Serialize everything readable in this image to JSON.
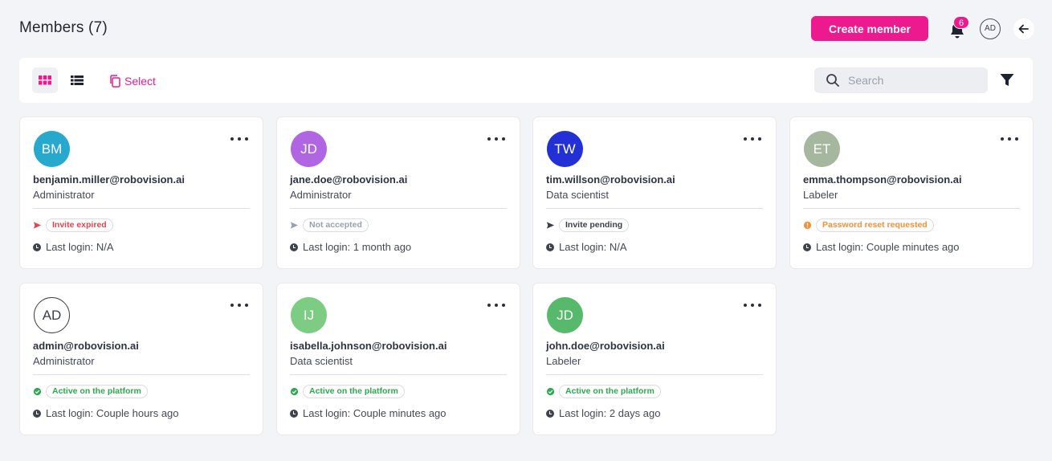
{
  "header": {
    "title": "Members (7)",
    "create_label": "Create member",
    "notification_count": "6",
    "user_initials": "AD",
    "accent": "#ec1a8e"
  },
  "toolbar": {
    "select_label": "Select",
    "search_placeholder": "Search",
    "search_value": ""
  },
  "members": [
    {
      "initials": "BM",
      "email": "benjamin.miller@robovision.ai",
      "role": "Administrator",
      "status": "Invite expired",
      "status_color": "#e2474f",
      "status_icon": "send-icon",
      "last_login": "Last login: N/A",
      "avatar_color": "#27a8cd"
    },
    {
      "initials": "JD",
      "email": "jane.doe@robovision.ai",
      "role": "Administrator",
      "status": "Not accepted",
      "status_color": "#9aa0b2",
      "status_icon": "send-icon",
      "last_login": "Last login: 1 month ago",
      "avatar_color": "#b066e3"
    },
    {
      "initials": "TW",
      "email": "tim.willson@robovision.ai",
      "role": "Data scientist",
      "status": "Invite pending",
      "status_color": "#3a3f4b",
      "status_icon": "send-icon",
      "last_login": "Last login: N/A",
      "avatar_color": "#2230d6"
    },
    {
      "initials": "ET",
      "email": "emma.thompson@robovision.ai",
      "role": "Labeler",
      "status": "Password reset requested",
      "status_color": "#f0913a",
      "status_icon": "warning-icon",
      "last_login": "Last login: Couple minutes ago",
      "avatar_color": "#a5b79f"
    },
    {
      "initials": "AD",
      "email": "admin@robovision.ai",
      "role": "Administrator",
      "status": "Active on the platform",
      "status_color": "#2eaa4e",
      "status_icon": "check-circle-icon",
      "last_login": "Last login: Couple hours ago",
      "avatar_color": "#ffffff"
    },
    {
      "initials": "IJ",
      "email": "isabella.johnson@robovision.ai",
      "role": "Data scientist",
      "status": "Active on the platform",
      "status_color": "#2eaa4e",
      "status_icon": "check-circle-icon",
      "last_login": "Last login: Couple minutes ago",
      "avatar_color": "#7dcc84"
    },
    {
      "initials": "JD",
      "email": "john.doe@robovision.ai",
      "role": "Labeler",
      "status": "Active on the platform",
      "status_color": "#2eaa4e",
      "status_icon": "check-circle-icon",
      "last_login": "Last login: 2 days ago",
      "avatar_color": "#57b96c"
    }
  ]
}
